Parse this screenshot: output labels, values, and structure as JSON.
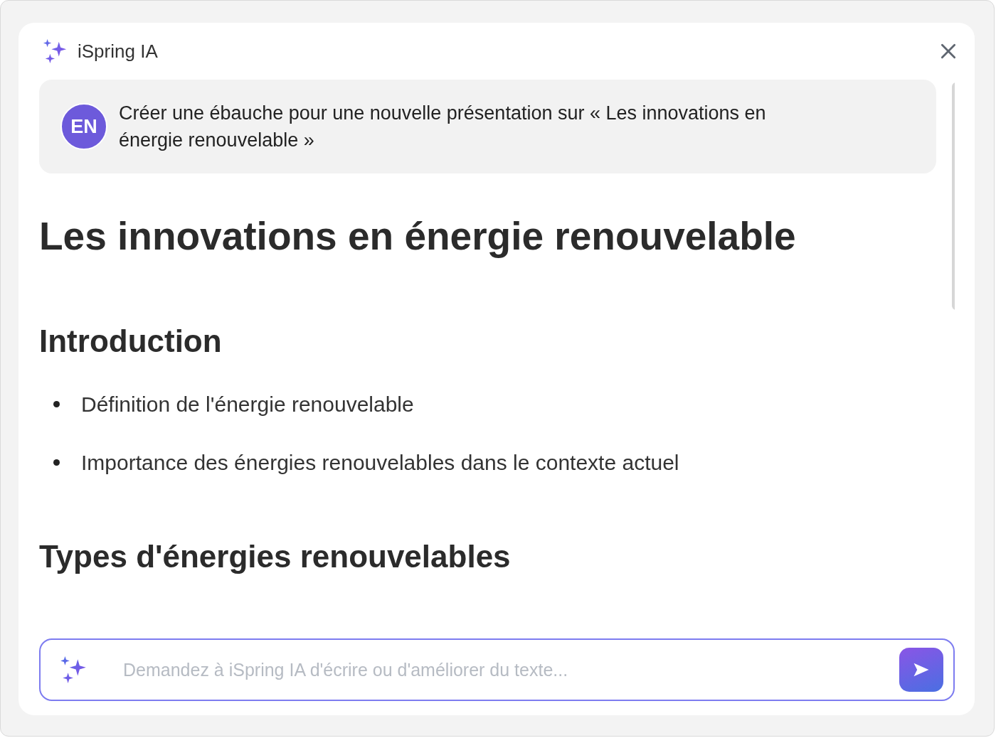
{
  "header": {
    "title": "iSpring IA"
  },
  "prompt": {
    "avatar": "EN",
    "text": "Créer une ébauche pour une nouvelle présentation sur « Les innovations en énergie renouvelable »"
  },
  "document": [
    {
      "kind": "heading1",
      "text": "Les innovations en énergie renouvelable"
    },
    {
      "kind": "heading2",
      "text": "Introduction"
    },
    {
      "kind": "bullet",
      "text": "Définition de l'énergie renouvelable"
    },
    {
      "kind": "bullet",
      "text": "Importance des énergies renouvelables dans le contexte actuel"
    },
    {
      "kind": "heading2",
      "text": "Types d'énergies renouvelables"
    }
  ],
  "composer": {
    "placeholder": "Demandez à iSpring IA d'écrire ou d'améliorer du texte..."
  }
}
